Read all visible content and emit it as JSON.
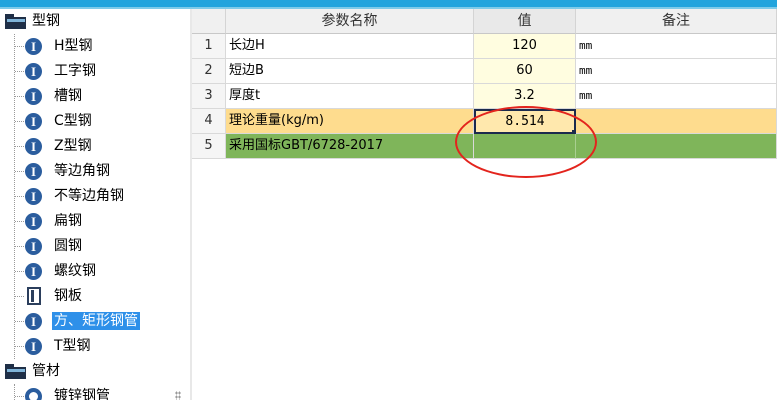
{
  "tree": {
    "groups": [
      {
        "label": "型钢",
        "icon": "folder-icon"
      },
      {
        "label": "管材",
        "icon": "folder-icon"
      }
    ],
    "items": [
      {
        "label": "H型钢",
        "icon": "i-beam-icon",
        "glyph": "I"
      },
      {
        "label": "工字钢",
        "icon": "i-beam-icon",
        "glyph": "I"
      },
      {
        "label": "槽钢",
        "icon": "i-beam-icon",
        "glyph": "I"
      },
      {
        "label": "C型钢",
        "icon": "i-beam-icon",
        "glyph": "I"
      },
      {
        "label": "Z型钢",
        "icon": "i-beam-icon",
        "glyph": "I"
      },
      {
        "label": "等边角钢",
        "icon": "i-beam-icon",
        "glyph": "I"
      },
      {
        "label": "不等边角钢",
        "icon": "i-beam-icon",
        "glyph": "I"
      },
      {
        "label": "扁钢",
        "icon": "i-beam-icon",
        "glyph": "I"
      },
      {
        "label": "圆钢",
        "icon": "i-beam-icon",
        "glyph": "I"
      },
      {
        "label": "螺纹钢",
        "icon": "i-beam-icon",
        "glyph": "I"
      },
      {
        "label": "钢板",
        "icon": "plate-icon"
      },
      {
        "label": "方、矩形钢管",
        "icon": "i-beam-icon",
        "glyph": "I",
        "selected": true
      },
      {
        "label": "T型钢",
        "icon": "i-beam-icon",
        "glyph": "I"
      },
      {
        "label": "镀锌钢管",
        "icon": "pipe-ring-icon"
      }
    ]
  },
  "grid": {
    "headers": {
      "name": "参数名称",
      "value": "值",
      "note": "备注"
    },
    "rows": [
      {
        "num": "1",
        "name": "长边H",
        "value": "120",
        "note": "mm"
      },
      {
        "num": "2",
        "name": "短边B",
        "value": "60",
        "note": "mm"
      },
      {
        "num": "3",
        "name": "厚度t",
        "value": "3.2",
        "note": "mm"
      },
      {
        "num": "4",
        "name": "理论重量(kg/m)",
        "value": "8.514",
        "note": ""
      },
      {
        "num": "5",
        "name": "采用国标GBT/6728-2017",
        "value": "",
        "note": ""
      }
    ]
  },
  "colors": {
    "accent": "#22a4dd",
    "selection": "#2e90e9",
    "weight_row": "#fedc8e",
    "standard_row": "#7fb55a",
    "annotation": "#e3241d"
  }
}
